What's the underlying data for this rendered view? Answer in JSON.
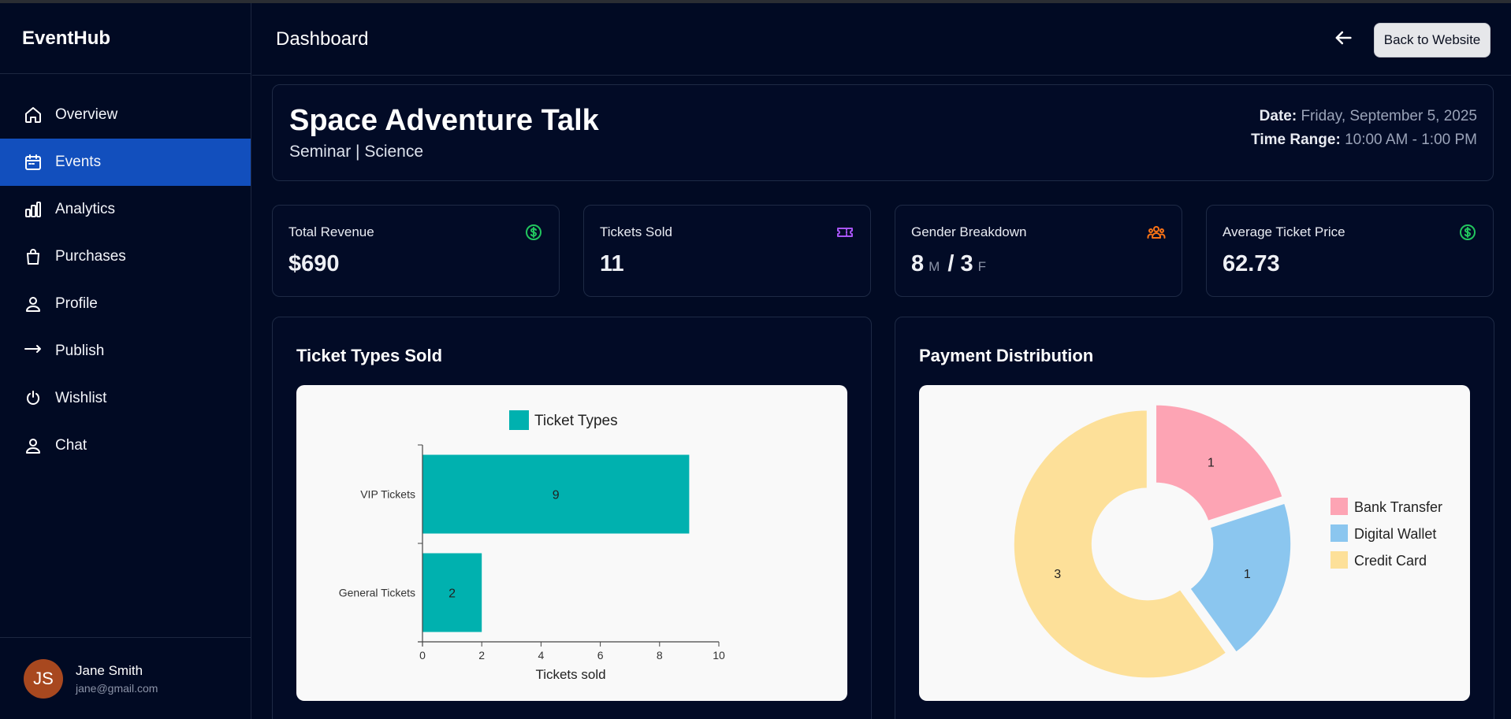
{
  "brand": "EventHub",
  "header": {
    "title": "Dashboard",
    "back_label": "Back to Website"
  },
  "nav": [
    {
      "label": "Overview",
      "icon": "home-icon"
    },
    {
      "label": "Events",
      "icon": "calendar-icon",
      "active": true
    },
    {
      "label": "Analytics",
      "icon": "bar-chart-icon"
    },
    {
      "label": "Purchases",
      "icon": "shopping-bag-icon"
    },
    {
      "label": "Profile",
      "icon": "user-icon"
    },
    {
      "label": "Publish",
      "icon": "arrow-right-icon"
    },
    {
      "label": "Wishlist",
      "icon": "heart-icon"
    },
    {
      "label": "Chat",
      "icon": "user-icon"
    }
  ],
  "user": {
    "initials": "JS",
    "name": "Jane Smith",
    "email": "jane@gmail.com"
  },
  "event": {
    "title": "Space Adventure Talk",
    "subtitle": "Seminar | Science",
    "date_label": "Date:",
    "date": "Friday, September 5, 2025",
    "time_label": "Time Range:",
    "time": "10:00 AM - 1:00 PM"
  },
  "stats": {
    "revenue": {
      "label": "Total Revenue",
      "value": "$690",
      "icon": "dollar-circle-icon"
    },
    "tickets": {
      "label": "Tickets Sold",
      "value": "11",
      "icon": "ticket-icon"
    },
    "gender": {
      "label": "Gender Breakdown",
      "male": "8",
      "male_unit": "M",
      "sep": "/",
      "female": "3",
      "female_unit": "F",
      "icon": "users-icon"
    },
    "avg_price": {
      "label": "Average Ticket Price",
      "value": "62.73",
      "icon": "dollar-circle-icon"
    }
  },
  "colors": {
    "accent": "#124fbd",
    "teal": "#00b1af",
    "pink": "#fda4b4",
    "blue": "#8bc6ef",
    "yellow": "#fde099",
    "green": "#22c55e",
    "purple": "#a855f7",
    "orange": "#f97316"
  },
  "charts": {
    "ticket_types_title": "Ticket Types Sold",
    "payment_title": "Payment Distribution"
  },
  "chart_data": [
    {
      "type": "bar",
      "orientation": "horizontal",
      "categories": [
        "VIP Tickets",
        "General Tickets"
      ],
      "series": [
        {
          "name": "Ticket Types",
          "values": [
            9,
            2
          ]
        }
      ],
      "xlabel": "Tickets sold",
      "xlim": [
        0,
        10
      ],
      "xticks": [
        "0",
        "2",
        "4",
        "6",
        "8",
        "10"
      ],
      "data_labels": [
        "9",
        "2"
      ],
      "legend": "top"
    },
    {
      "type": "pie",
      "style": "doughnut",
      "labels": [
        "Bank Transfer",
        "Digital Wallet",
        "Credit Card"
      ],
      "values": [
        1,
        1,
        3
      ],
      "data_labels": [
        "1",
        "1",
        "3"
      ],
      "legend": "right"
    }
  ]
}
